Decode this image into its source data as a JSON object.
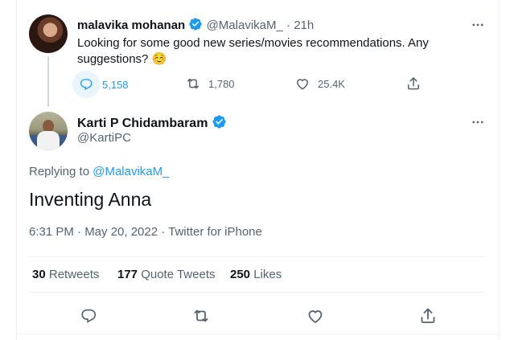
{
  "parent_tweet": {
    "author_name": "malavika mohanan",
    "handle": "@MalavikaM_",
    "separator": "·",
    "time": "21h",
    "text": "Looking for some good new series/movies recommendations. Any suggestions? ☺️",
    "replies": "5,158",
    "retweets": "1,780",
    "likes": "25.4K"
  },
  "main_tweet": {
    "author_name": "Karti P Chidambaram",
    "handle": "@KartiPC",
    "replying_prefix": "Replying to",
    "replying_to": "@MalavikaM_",
    "text": "Inventing Anna",
    "timestamp": "6:31 PM · May 20, 2022 · Twitter for iPhone",
    "stats": {
      "retweets_count": "30",
      "retweets_label": "Retweets",
      "quote_count": "177",
      "quote_label": "Quote Tweets",
      "likes_count": "250",
      "likes_label": "Likes"
    }
  },
  "colors": {
    "accent": "#1d9bf0",
    "muted": "#536471",
    "text": "#0f1419"
  }
}
